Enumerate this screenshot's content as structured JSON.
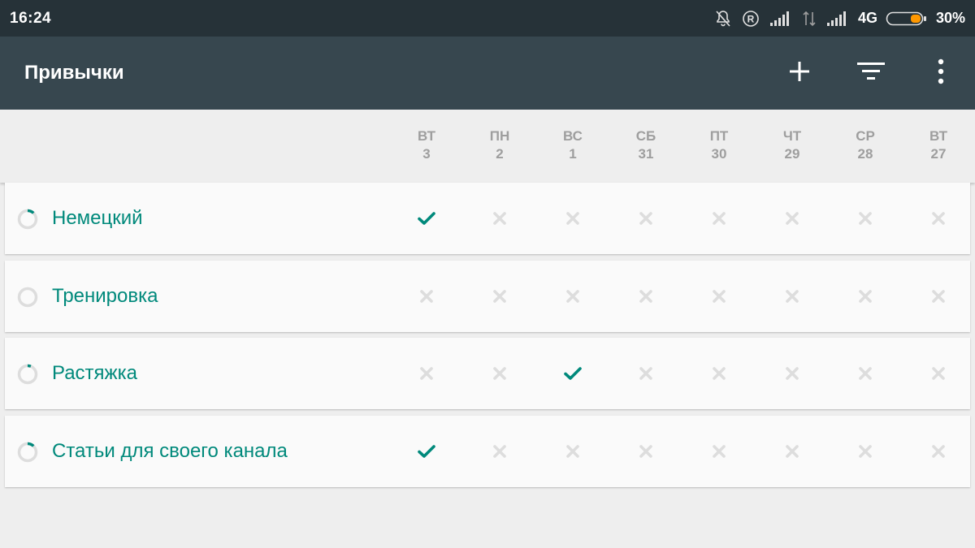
{
  "status_bar": {
    "time": "16:24",
    "network": "4G",
    "battery": "30%",
    "icons": [
      "notifications-off-icon",
      "registered-icon",
      "signal-icon",
      "data-transfer-icon",
      "signal-icon",
      "battery-icon"
    ]
  },
  "app_bar": {
    "title": "Привычки",
    "actions": [
      "add-icon",
      "filter-icon",
      "more-vert-icon"
    ]
  },
  "days": [
    {
      "dow": "ВТ",
      "date": "3"
    },
    {
      "dow": "ПН",
      "date": "2"
    },
    {
      "dow": "ВС",
      "date": "1"
    },
    {
      "dow": "СБ",
      "date": "31"
    },
    {
      "dow": "ПТ",
      "date": "30"
    },
    {
      "dow": "ЧТ",
      "date": "29"
    },
    {
      "dow": "СР",
      "date": "28"
    },
    {
      "dow": "ВТ",
      "date": "27"
    }
  ],
  "habits": [
    {
      "name": "Немецкий",
      "score": 0.12,
      "checks": [
        true,
        false,
        false,
        false,
        false,
        false,
        false,
        false
      ]
    },
    {
      "name": "Тренировка",
      "score": 0,
      "checks": [
        false,
        false,
        false,
        false,
        false,
        false,
        false,
        false
      ]
    },
    {
      "name": "Растяжка",
      "score": 0.06,
      "checks": [
        false,
        false,
        true,
        false,
        false,
        false,
        false,
        false
      ]
    },
    {
      "name": "Статьи для своего канала",
      "score": 0.12,
      "checks": [
        true,
        false,
        false,
        false,
        false,
        false,
        false,
        false
      ]
    }
  ],
  "colors": {
    "status_bar": "#263238",
    "app_bar": "#37474f",
    "accent": "#00897b",
    "unchecked": "#dddddd",
    "battery_fill": "#ff9800"
  }
}
